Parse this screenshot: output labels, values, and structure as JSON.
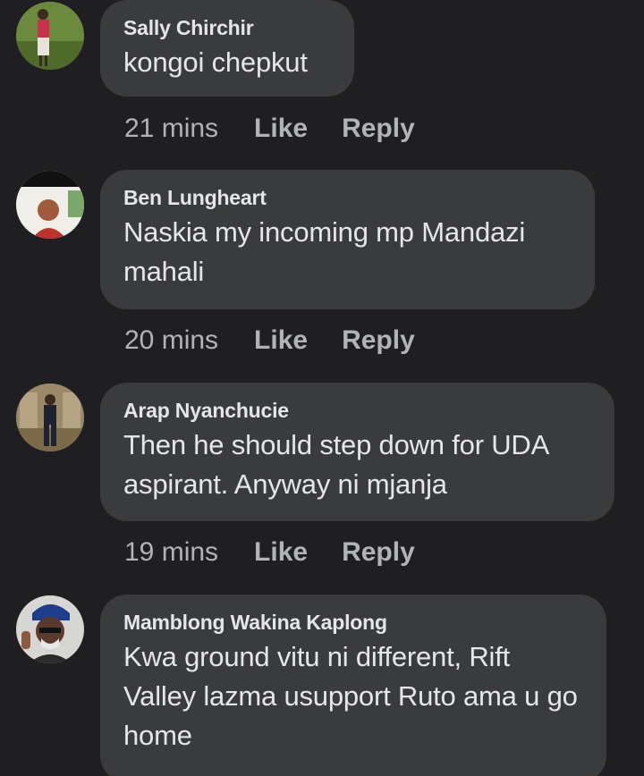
{
  "comments": [
    {
      "author": "Sally Chirchir",
      "text": "kongoi chepkut",
      "time": "21 mins",
      "like_label": "Like",
      "reply_label": "Reply",
      "avatar_icon": "person-photo-icon"
    },
    {
      "author": "Ben Lungheart",
      "text": "Naskia my incoming mp Mandazi mahali",
      "time": "20 mins",
      "like_label": "Like",
      "reply_label": "Reply",
      "avatar_icon": "person-photo-icon"
    },
    {
      "author": "Arap Nyanchucie",
      "text": "Then he should step down for UDA aspirant. Anyway ni mjanja",
      "time": "19 mins",
      "like_label": "Like",
      "reply_label": "Reply",
      "avatar_icon": "person-photo-icon"
    },
    {
      "author": "Mamblong Wakina Kaplong",
      "text": "Kwa ground vitu ni different, Rift Valley lazma usupport Ruto ama u go home",
      "avatar_icon": "person-photo-icon"
    }
  ],
  "colors": {
    "background": "#1f1f21",
    "bubble": "#3a3b3c",
    "primary_text": "#e4e6eb",
    "secondary_text": "#b0b3b8"
  }
}
